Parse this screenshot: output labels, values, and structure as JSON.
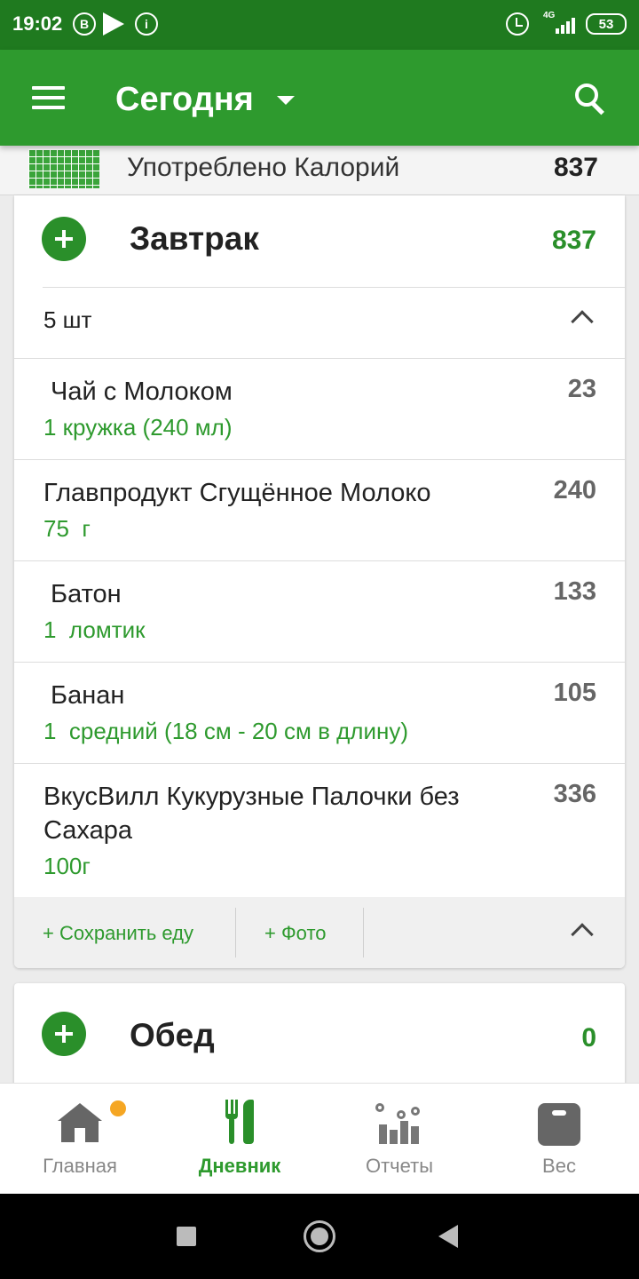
{
  "status_bar": {
    "time": "19:02",
    "notif_icons": [
      "B",
      "i"
    ],
    "network": "4G",
    "battery": "53"
  },
  "app_bar": {
    "title": "Сегодня",
    "icons": [
      "menu-icon",
      "chevron-down-icon",
      "search-icon"
    ]
  },
  "summary": {
    "label": "Употреблено Калорий",
    "value": "837"
  },
  "breakfast": {
    "title": "Завтрак",
    "calories": "837",
    "count_label": "5 шт",
    "items": [
      {
        "name": " Чай с Молоком",
        "portion": "1 кружка (240 мл)",
        "calories": "23"
      },
      {
        "name": "Главпродукт Сгущённое Молоко",
        "portion": "75  г",
        "calories": "240"
      },
      {
        "name": " Батон",
        "portion": "1  ломтик",
        "calories": "133"
      },
      {
        "name": " Банан",
        "portion": "1  средний (18 см - 20 см в длину)",
        "calories": "105"
      },
      {
        "name": "ВкусВилл Кукурузные Палочки без Сахара",
        "portion": "100г",
        "calories": "336"
      }
    ],
    "actions": {
      "save_food": "+ Сохранить еду",
      "photo": "+ Фото"
    }
  },
  "lunch": {
    "title": "Обед",
    "calories": "0"
  },
  "bottom_nav": {
    "items": [
      {
        "label": "Главная",
        "icon": "home-icon",
        "active": false
      },
      {
        "label": "Дневник",
        "icon": "fork-knife-icon",
        "active": true
      },
      {
        "label": "Отчеты",
        "icon": "reports-icon",
        "active": false
      },
      {
        "label": "Вес",
        "icon": "scale-icon",
        "active": false
      }
    ]
  },
  "colors": {
    "status_bar": "#1f7a1f",
    "app_bar": "#2e9a2e",
    "accent": "#2a8f2a",
    "notification_dot": "#f5a623"
  }
}
